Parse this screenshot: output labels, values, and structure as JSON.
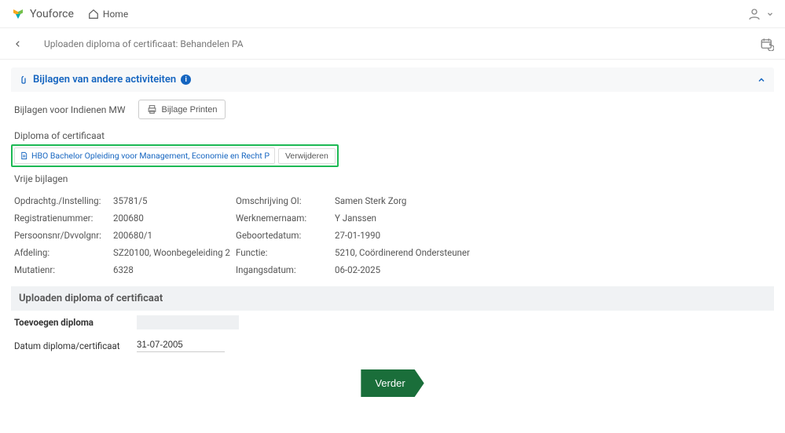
{
  "header": {
    "brand": "Youforce",
    "home_label": "Home"
  },
  "subheader": {
    "title": "Uploaden diploma of certificaat: Behandelen PA"
  },
  "section": {
    "title": "Bijlagen van andere activiteiten",
    "attach_label": "Bijlagen voor Indienen MW",
    "print_label": "Bijlage Printen",
    "diploma_label": "Diploma of certificaat",
    "file_name": "HBO Bachelor Opleiding voor Management, Economie en Recht P",
    "remove_label": "Verwijderen",
    "vrije_label": "Vrije bijlagen"
  },
  "details": {
    "rows": [
      {
        "l1": "Opdrachtg./Instelling:",
        "v1": "35781/5",
        "l2": "Omschrijving OI:",
        "v2": "Samen Sterk Zorg"
      },
      {
        "l1": "Registratienummer:",
        "v1": "200680",
        "l2": "Werknemernaam:",
        "v2": "Y Janssen"
      },
      {
        "l1": "Persoonsnr/Dvvolgnr:",
        "v1": "200680/1",
        "l2": "Geboortedatum:",
        "v2": "27-01-1990"
      },
      {
        "l1": "Afdeling:",
        "v1": "SZ20100, Woonbegeleiding 2",
        "l2": "Functie:",
        "v2": "5210, Coördinerend Ondersteuner"
      },
      {
        "l1": "Mutatienr:",
        "v1": "6328",
        "l2": "Ingangsdatum:",
        "v2": "06-02-2025"
      }
    ]
  },
  "upload": {
    "header": "Uploaden diploma of certificaat",
    "toevoegen": "Toevoegen diploma",
    "datum_label": "Datum diploma/certificaat",
    "datum_value": "31-07-2005"
  },
  "actions": {
    "proceed": "Verder"
  }
}
